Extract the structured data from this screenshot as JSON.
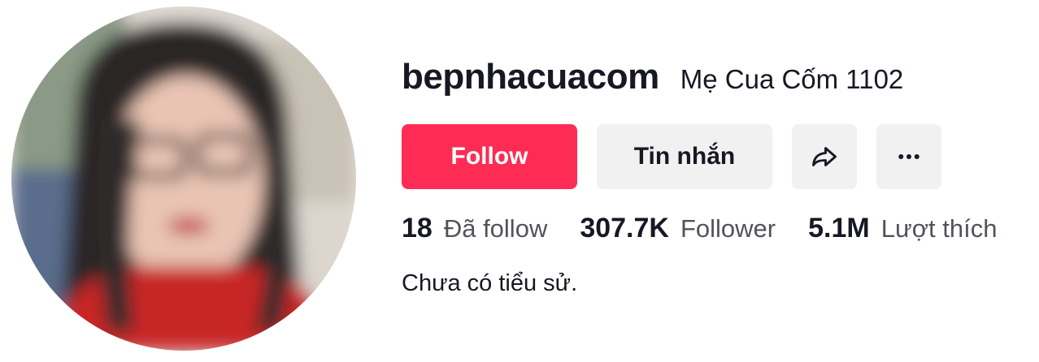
{
  "profile": {
    "username": "bepnhacuacom",
    "nickname": "Mẹ Cua Cốm 1102",
    "bio": "Chưa có tiểu sử.",
    "avatar_icon": "avatar-photo-blurred"
  },
  "actions": {
    "follow_label": "Follow",
    "message_label": "Tin nhắn",
    "share_icon": "share-arrow-icon",
    "more_icon": "more-dots-icon"
  },
  "stats": [
    {
      "value": "18",
      "label": "Đã follow"
    },
    {
      "value": "307.7K",
      "label": "Follower"
    },
    {
      "value": "5.1M",
      "label": "Lượt thích"
    }
  ],
  "colors": {
    "follow_button": "#fe2c55",
    "secondary_button": "#f1f1f2",
    "text_primary": "#161823"
  }
}
